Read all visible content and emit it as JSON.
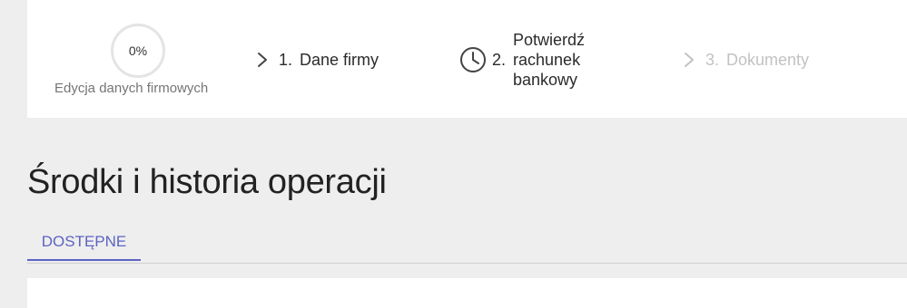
{
  "progress": {
    "percent_label": "0%",
    "percent_value": 0,
    "label": "Edycja danych firmowych",
    "ring_color": "#e4e4e4"
  },
  "steps": [
    {
      "number": "1.",
      "label": "Dane firmy",
      "icon": "chevron-right-icon",
      "state": "active"
    },
    {
      "number": "2.",
      "label": "Potwierdź rachunek bankowy",
      "icon": "clock-icon",
      "state": "pending"
    },
    {
      "number": "3.",
      "label": "Dokumenty",
      "icon": "chevron-right-icon",
      "state": "disabled"
    }
  ],
  "page": {
    "title": "Środki i historia operacji"
  },
  "tabs": [
    {
      "label": "DOSTĘPNE",
      "selected": true
    }
  ],
  "colors": {
    "accent": "#5c63c3",
    "background": "#eeeeee",
    "card": "#ffffff",
    "text": "#2b2b2b",
    "muted": "#757575",
    "disabled": "#c2c2c2"
  }
}
